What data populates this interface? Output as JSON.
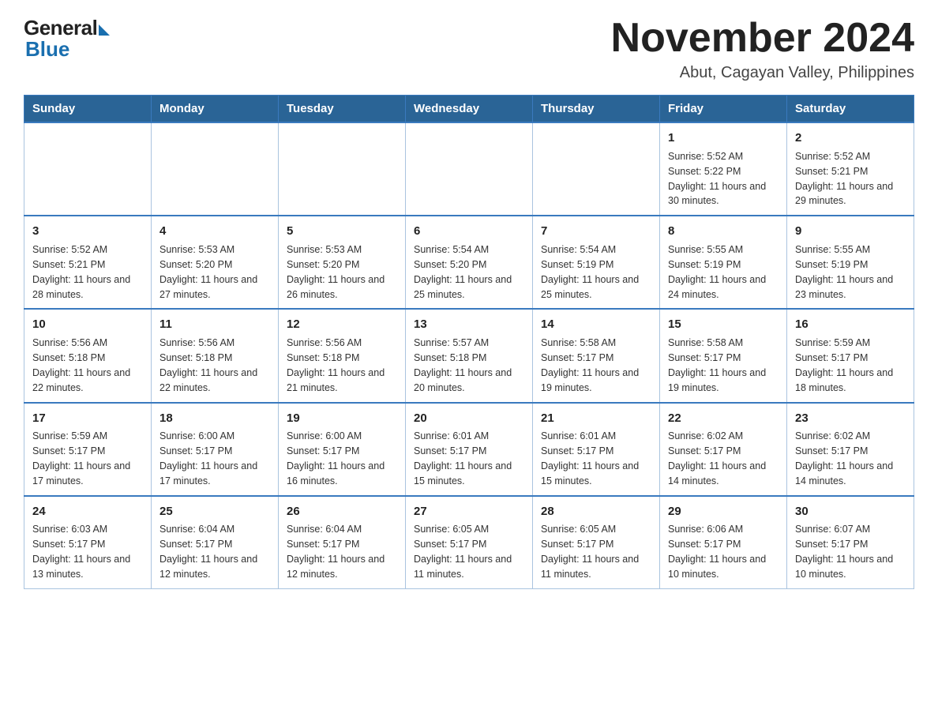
{
  "header": {
    "logo_general": "General",
    "logo_blue": "Blue",
    "month_title": "November 2024",
    "location": "Abut, Cagayan Valley, Philippines"
  },
  "days_of_week": [
    "Sunday",
    "Monday",
    "Tuesday",
    "Wednesday",
    "Thursday",
    "Friday",
    "Saturday"
  ],
  "weeks": [
    [
      {
        "day": "",
        "info": ""
      },
      {
        "day": "",
        "info": ""
      },
      {
        "day": "",
        "info": ""
      },
      {
        "day": "",
        "info": ""
      },
      {
        "day": "",
        "info": ""
      },
      {
        "day": "1",
        "info": "Sunrise: 5:52 AM\nSunset: 5:22 PM\nDaylight: 11 hours and 30 minutes."
      },
      {
        "day": "2",
        "info": "Sunrise: 5:52 AM\nSunset: 5:21 PM\nDaylight: 11 hours and 29 minutes."
      }
    ],
    [
      {
        "day": "3",
        "info": "Sunrise: 5:52 AM\nSunset: 5:21 PM\nDaylight: 11 hours and 28 minutes."
      },
      {
        "day": "4",
        "info": "Sunrise: 5:53 AM\nSunset: 5:20 PM\nDaylight: 11 hours and 27 minutes."
      },
      {
        "day": "5",
        "info": "Sunrise: 5:53 AM\nSunset: 5:20 PM\nDaylight: 11 hours and 26 minutes."
      },
      {
        "day": "6",
        "info": "Sunrise: 5:54 AM\nSunset: 5:20 PM\nDaylight: 11 hours and 25 minutes."
      },
      {
        "day": "7",
        "info": "Sunrise: 5:54 AM\nSunset: 5:19 PM\nDaylight: 11 hours and 25 minutes."
      },
      {
        "day": "8",
        "info": "Sunrise: 5:55 AM\nSunset: 5:19 PM\nDaylight: 11 hours and 24 minutes."
      },
      {
        "day": "9",
        "info": "Sunrise: 5:55 AM\nSunset: 5:19 PM\nDaylight: 11 hours and 23 minutes."
      }
    ],
    [
      {
        "day": "10",
        "info": "Sunrise: 5:56 AM\nSunset: 5:18 PM\nDaylight: 11 hours and 22 minutes."
      },
      {
        "day": "11",
        "info": "Sunrise: 5:56 AM\nSunset: 5:18 PM\nDaylight: 11 hours and 22 minutes."
      },
      {
        "day": "12",
        "info": "Sunrise: 5:56 AM\nSunset: 5:18 PM\nDaylight: 11 hours and 21 minutes."
      },
      {
        "day": "13",
        "info": "Sunrise: 5:57 AM\nSunset: 5:18 PM\nDaylight: 11 hours and 20 minutes."
      },
      {
        "day": "14",
        "info": "Sunrise: 5:58 AM\nSunset: 5:17 PM\nDaylight: 11 hours and 19 minutes."
      },
      {
        "day": "15",
        "info": "Sunrise: 5:58 AM\nSunset: 5:17 PM\nDaylight: 11 hours and 19 minutes."
      },
      {
        "day": "16",
        "info": "Sunrise: 5:59 AM\nSunset: 5:17 PM\nDaylight: 11 hours and 18 minutes."
      }
    ],
    [
      {
        "day": "17",
        "info": "Sunrise: 5:59 AM\nSunset: 5:17 PM\nDaylight: 11 hours and 17 minutes."
      },
      {
        "day": "18",
        "info": "Sunrise: 6:00 AM\nSunset: 5:17 PM\nDaylight: 11 hours and 17 minutes."
      },
      {
        "day": "19",
        "info": "Sunrise: 6:00 AM\nSunset: 5:17 PM\nDaylight: 11 hours and 16 minutes."
      },
      {
        "day": "20",
        "info": "Sunrise: 6:01 AM\nSunset: 5:17 PM\nDaylight: 11 hours and 15 minutes."
      },
      {
        "day": "21",
        "info": "Sunrise: 6:01 AM\nSunset: 5:17 PM\nDaylight: 11 hours and 15 minutes."
      },
      {
        "day": "22",
        "info": "Sunrise: 6:02 AM\nSunset: 5:17 PM\nDaylight: 11 hours and 14 minutes."
      },
      {
        "day": "23",
        "info": "Sunrise: 6:02 AM\nSunset: 5:17 PM\nDaylight: 11 hours and 14 minutes."
      }
    ],
    [
      {
        "day": "24",
        "info": "Sunrise: 6:03 AM\nSunset: 5:17 PM\nDaylight: 11 hours and 13 minutes."
      },
      {
        "day": "25",
        "info": "Sunrise: 6:04 AM\nSunset: 5:17 PM\nDaylight: 11 hours and 12 minutes."
      },
      {
        "day": "26",
        "info": "Sunrise: 6:04 AM\nSunset: 5:17 PM\nDaylight: 11 hours and 12 minutes."
      },
      {
        "day": "27",
        "info": "Sunrise: 6:05 AM\nSunset: 5:17 PM\nDaylight: 11 hours and 11 minutes."
      },
      {
        "day": "28",
        "info": "Sunrise: 6:05 AM\nSunset: 5:17 PM\nDaylight: 11 hours and 11 minutes."
      },
      {
        "day": "29",
        "info": "Sunrise: 6:06 AM\nSunset: 5:17 PM\nDaylight: 11 hours and 10 minutes."
      },
      {
        "day": "30",
        "info": "Sunrise: 6:07 AM\nSunset: 5:17 PM\nDaylight: 11 hours and 10 minutes."
      }
    ]
  ]
}
